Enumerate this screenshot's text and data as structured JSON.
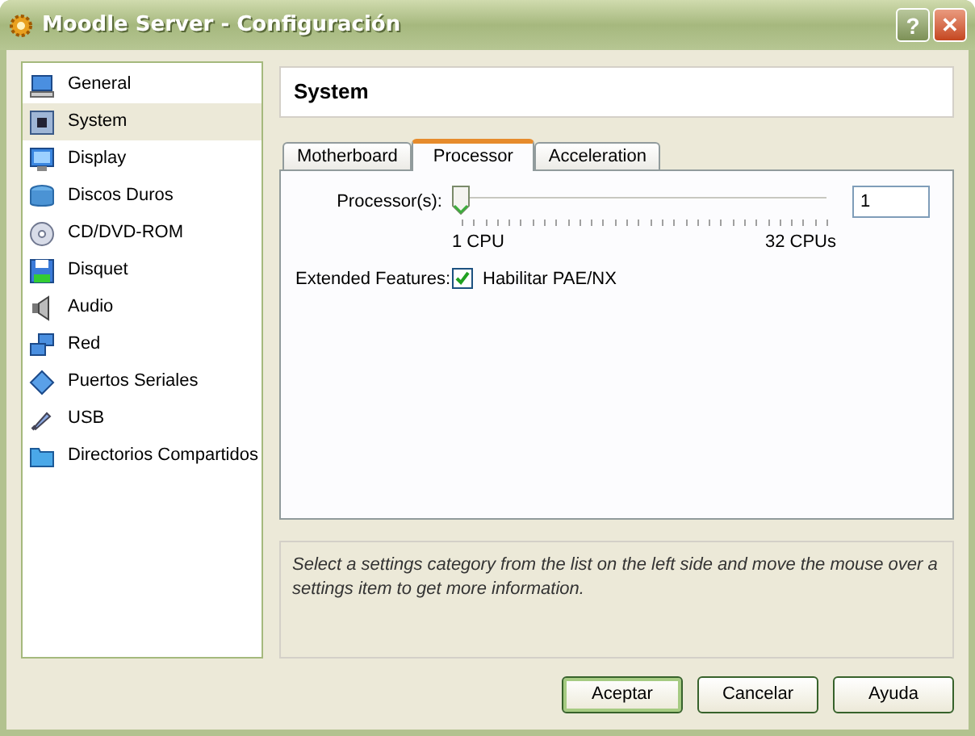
{
  "window": {
    "title": "Moodle Server - Configuración",
    "buttons": [
      "?",
      "✕"
    ]
  },
  "sidebar": {
    "items": [
      {
        "label": "General",
        "selected": false
      },
      {
        "label": "System",
        "selected": true
      },
      {
        "label": "Display",
        "selected": false
      },
      {
        "label": "Discos Duros",
        "selected": false
      },
      {
        "label": "CD/DVD-ROM",
        "selected": false
      },
      {
        "label": "Disquet",
        "selected": false
      },
      {
        "label": "Audio",
        "selected": false
      },
      {
        "label": "Red",
        "selected": false
      },
      {
        "label": "Puertos Seriales",
        "selected": false
      },
      {
        "label": "USB",
        "selected": false
      },
      {
        "label": "Directorios Compartidos",
        "selected": false
      }
    ]
  },
  "page_title": "System",
  "tabs": [
    {
      "label": "Motherboard",
      "selected": false
    },
    {
      "label": "Processor",
      "selected": true
    },
    {
      "label": "Acceleration",
      "selected": false
    }
  ],
  "processor": {
    "label": "Processor(s):",
    "level": 0,
    "value": "1",
    "min_label": "1 CPU",
    "max_label": "32 CPUs"
  },
  "extended": {
    "label": "Extended Features:",
    "option": "Habilitar PAE/NX",
    "checked": true
  },
  "description": "Select a settings category from the list on the left side and move the mouse over a settings item to get more information.",
  "buttons": [
    {
      "label": "Aceptar",
      "default": true
    },
    {
      "label": "Cancelar",
      "default": false
    },
    {
      "label": "Ayuda",
      "default": false
    }
  ]
}
